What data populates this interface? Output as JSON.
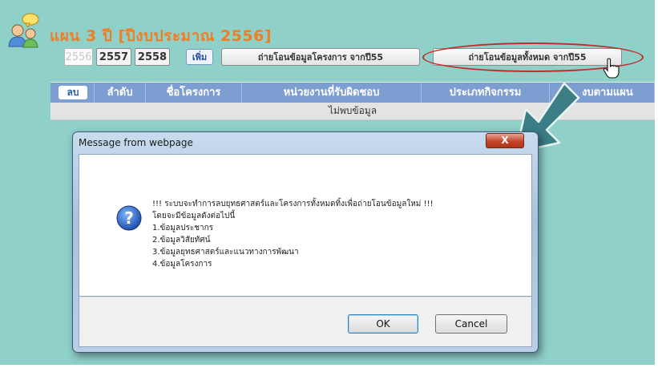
{
  "page": {
    "title": "แผน 3 ปี [ปีงบประมาณ 2556]"
  },
  "toolbar": {
    "years": [
      "2556",
      "2557",
      "2558"
    ],
    "more_label": "เพิ่ม",
    "import_project_label": "ถ่ายโอนข้อมูลโครงการ จากปี55",
    "import_all_label": "ถ่ายโอนข้อมูลทั้งหมด จากปี55"
  },
  "table": {
    "delete_label": "ลบ",
    "columns": [
      "ลำดับ",
      "ชื่อโครงการ",
      "หน่วยงานที่รับผิดชอบ",
      "ประเภทกิจกรรม",
      "งบตามแผน"
    ],
    "empty_text": "ไม่พบข้อมูล"
  },
  "dialog": {
    "title": "Message from webpage",
    "close_label": "X",
    "message": "!!! ระบบจะทำการลบยุทธศาสตร์และโครงการทั้งหมดทิ้งเพื่อถ่ายโอนข้อมูลใหม่ !!!\nโดยจะมีข้อมูลดังต่อไปนี้\n1.ข้อมูลประชากร\n2.ข้อมูลวิสัยทัศน์\n3.ข้อมูลยุทธศาสตร์และแนวทางการพัฒนา\n4.ข้อมูลโครงการ",
    "ok_label": "OK",
    "cancel_label": "Cancel"
  },
  "icons": {
    "people": "people-chat-icon",
    "cursor": "hand-cursor-icon",
    "question": "question-icon",
    "annotation_arrow": "arrow-annotation-icon"
  },
  "colors": {
    "background": "#8fd0c9",
    "title": "#ef7e24",
    "table_header": "#7d9ed1",
    "highlight": "#c22c2c",
    "arrow": "#3b7e86"
  }
}
